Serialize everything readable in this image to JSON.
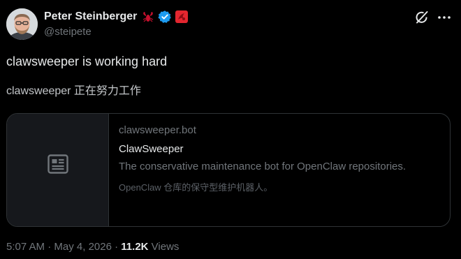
{
  "author": {
    "display_name": "Peter Steinberger",
    "handle": "@steipete",
    "avatar_icon": "avatar-photo",
    "badges": [
      "lobster-icon",
      "verified-badge-icon",
      "red-box-icon"
    ]
  },
  "header_actions": {
    "grok_icon": "grok-icon",
    "more_icon": "more-options-icon"
  },
  "tweet": {
    "text": "clawsweeper is working hard",
    "translated_text": "clawsweeper 正在努力工作"
  },
  "link_card": {
    "thumbnail_icon": "news-article-icon",
    "domain": "clawsweeper.bot",
    "title": "ClawSweeper",
    "description": "The conservative maintenance bot for OpenClaw repositories.",
    "description_translated": "OpenClaw 仓库的保守型维护机器人。"
  },
  "meta": {
    "time": "5:07 AM",
    "separator": "·",
    "date": "May 4, 2026",
    "views_count": "11.2K",
    "views_label": "Views"
  },
  "colors": {
    "background": "#000000",
    "text_primary": "#e7e9ea",
    "text_secondary": "#71767b",
    "border": "#2f3336",
    "verified_blue": "#1d9bf0"
  }
}
